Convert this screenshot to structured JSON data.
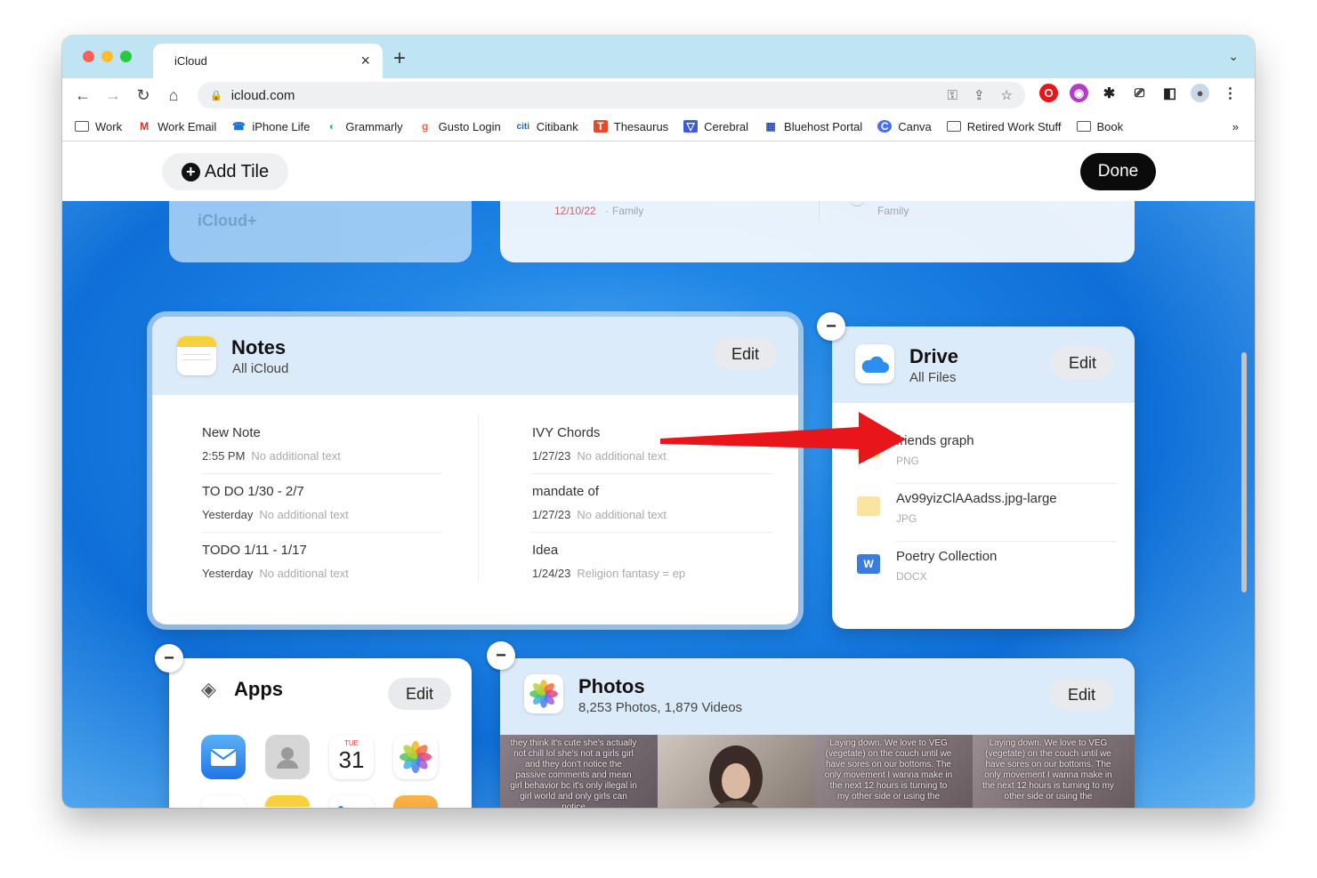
{
  "browser": {
    "tab": {
      "title": "iCloud",
      "favicon": "apple-icon"
    },
    "url": "icloud.com",
    "bookmarks": [
      "Work",
      "Work Email",
      "iPhone Life",
      "Grammarly",
      "Gusto Login",
      "Citibank",
      "Thesaurus",
      "Cerebral",
      "Bluehost Portal",
      "Canva",
      "Retired Work Stuff",
      "Book"
    ],
    "bookmarks_more": "»"
  },
  "editbar": {
    "add_label": "Add Tile",
    "done_label": "Done"
  },
  "top_row": {
    "icloud_plus": "iCloud+",
    "mail_date": "12/10/22",
    "mail_sep": "·",
    "mail_family": "Family",
    "family_label": "Family"
  },
  "notes": {
    "title": "Notes",
    "subtitle": "All iCloud",
    "edit": "Edit",
    "items": [
      {
        "title": "New Note",
        "date": "2:55 PM",
        "preview": "No additional text"
      },
      {
        "title": "TO DO 1/30 - 2/7",
        "date": "Yesterday",
        "preview": "No additional text"
      },
      {
        "title": "TODO 1/11 - 1/17",
        "date": "Yesterday",
        "preview": "No additional text"
      },
      {
        "title": "IVY Chords",
        "date": "1/27/23",
        "preview": "No additional text"
      },
      {
        "title": "mandate of",
        "date": "1/27/23",
        "preview": "No additional text"
      },
      {
        "title": "Idea",
        "date": "1/24/23",
        "preview": "Religion fantasy = ep"
      }
    ]
  },
  "drive": {
    "title": "Drive",
    "subtitle": "All Files",
    "edit": "Edit",
    "files": [
      {
        "name": "friends graph",
        "type": "PNG"
      },
      {
        "name": "Av99yizClAAadss.jpg-large",
        "type": "JPG"
      },
      {
        "name": "Poetry Collection",
        "type": "DOCX"
      }
    ]
  },
  "apps": {
    "title": "Apps",
    "edit": "Edit",
    "calendar_day": "TUE",
    "calendar_date": "31"
  },
  "photos": {
    "title": "Photos",
    "subtitle": "8,253 Photos, 1,879 Videos",
    "edit": "Edit",
    "captions": [
      "they think it's cute she's actually not chill lol she's not a girls girl and they don't notice the passive comments and mean girl behavior bc it's only illegal in girl world and only girls can notice",
      "",
      "Laying down. We love to VEG (vegetate) on the couch until we have sores on our bottoms. The only movement I wanna make in the next 12 hours is turning to my other side or using the",
      "Laying down. We love to VEG (vegetate) on the couch until we have sores on our bottoms. The only movement I wanna make in the next 12 hours is turning to my other side or using the"
    ]
  },
  "colors": {
    "accent": "#0f6fd8",
    "annotation_arrow": "#e8161b"
  }
}
